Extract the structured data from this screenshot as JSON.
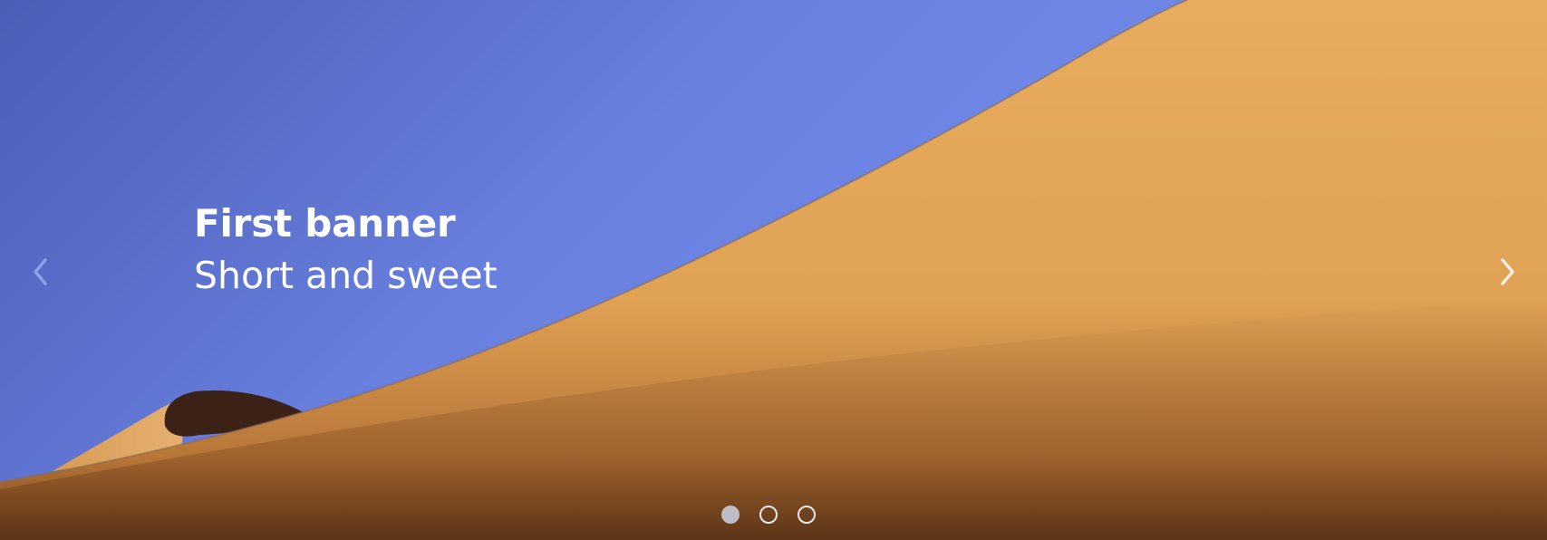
{
  "banner": {
    "title": "First banner",
    "subtitle": "Short and sweet"
  },
  "navigation": {
    "prev_icon": "chevron-left-icon",
    "next_icon": "chevron-right-icon"
  },
  "indicators": {
    "count": 3,
    "active_index": 0
  },
  "colors": {
    "sky": "#6b82e0",
    "sand": "#e2a75a",
    "text": "#ffffff"
  }
}
